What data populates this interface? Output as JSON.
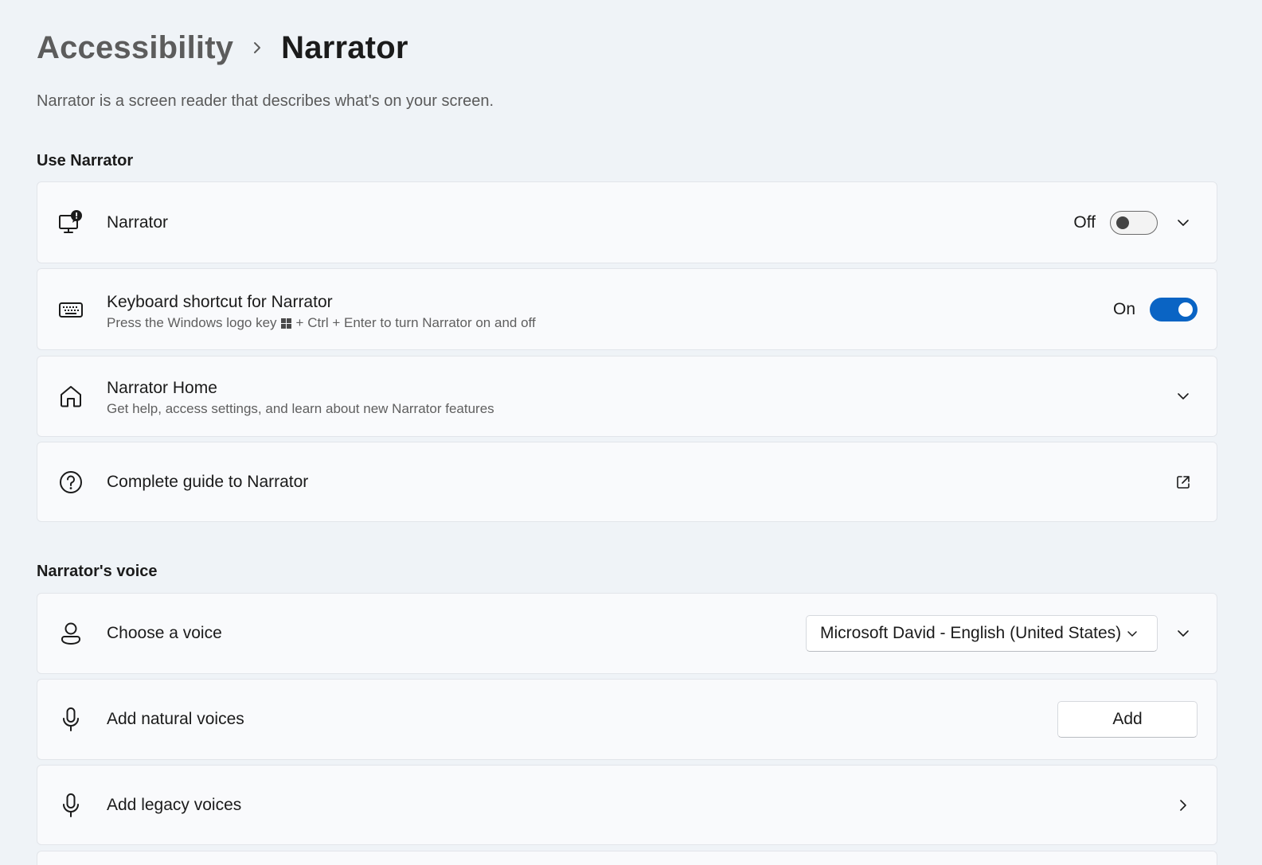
{
  "breadcrumb": {
    "parent": "Accessibility",
    "current": "Narrator"
  },
  "page_description": "Narrator is a screen reader that describes what's on your screen.",
  "sections": {
    "use_narrator": {
      "title": "Use Narrator",
      "narrator": {
        "title": "Narrator",
        "state_label": "Off",
        "toggle_on": false
      },
      "keyboard_shortcut": {
        "title": "Keyboard shortcut for Narrator",
        "subtitle_before": "Press the Windows logo key",
        "subtitle_after": "+ Ctrl + Enter to turn Narrator on and off",
        "state_label": "On",
        "toggle_on": true
      },
      "narrator_home": {
        "title": "Narrator Home",
        "subtitle": "Get help, access settings, and learn about new Narrator features"
      },
      "complete_guide": {
        "title": "Complete guide to Narrator"
      }
    },
    "narrators_voice": {
      "title": "Narrator's voice",
      "choose_voice": {
        "title": "Choose a voice",
        "selected": "Microsoft David - English (United States)"
      },
      "natural_voices": {
        "title": "Add natural voices",
        "button": "Add"
      },
      "legacy_voices": {
        "title": "Add legacy voices"
      }
    }
  },
  "icons": {
    "narrator": "narrator-monitor-icon",
    "keyboard": "keyboard-icon",
    "home": "home-icon",
    "help": "help-circle-icon",
    "person": "person-icon",
    "microphone": "microphone-icon",
    "external": "open-external-icon",
    "chevron_down": "chevron-down-icon",
    "chevron_right": "chevron-right-icon"
  },
  "colors": {
    "accent": "#0a64c4",
    "background": "#eff3f7",
    "card": "#f9fafc"
  }
}
